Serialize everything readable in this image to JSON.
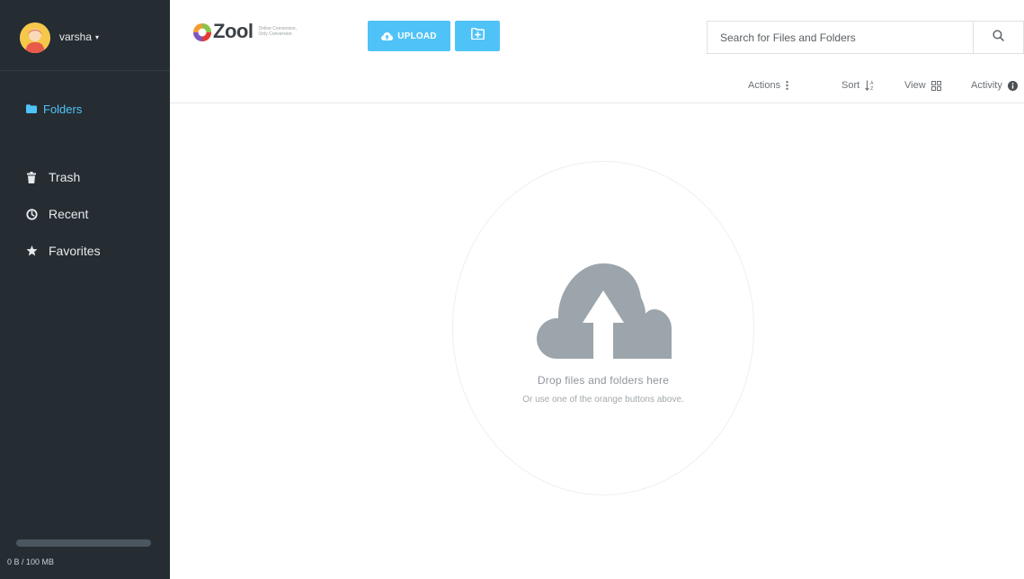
{
  "sidebar": {
    "user": {
      "name": "varsha",
      "caret": "▾"
    },
    "items": [
      {
        "label": "Folders",
        "icon": "folder-icon",
        "active": true
      },
      {
        "label": "Trash",
        "icon": "trash-icon"
      },
      {
        "label": "Recent",
        "icon": "clock-icon"
      },
      {
        "label": "Favorites",
        "icon": "star-icon"
      }
    ],
    "storage": {
      "text": "0 B / 100 MB",
      "used_fraction": 0
    }
  },
  "header": {
    "logo": {
      "brand": "Zool",
      "tagline": "Online Conversion, Only Conversion.",
      "icon": "zool-logo-icon"
    },
    "upload_label": "UPLOAD",
    "upload_icon": "cloud-upload-icon",
    "new_folder_icon": "new-folder-icon",
    "search": {
      "placeholder": "Search for Files and Folders",
      "icon": "search-icon"
    }
  },
  "toolbar": {
    "actions": "Actions",
    "sort": "Sort",
    "view": "View",
    "activity": "Activity"
  },
  "dropzone": {
    "title": "Drop files and folders here",
    "subtitle": "Or use one of the orange buttons above.",
    "icon": "cloud-upload-icon"
  },
  "colors": {
    "sidebar_bg": "#252d33",
    "accent": "#4fc3f7",
    "cloud": "#9ba5ab"
  }
}
